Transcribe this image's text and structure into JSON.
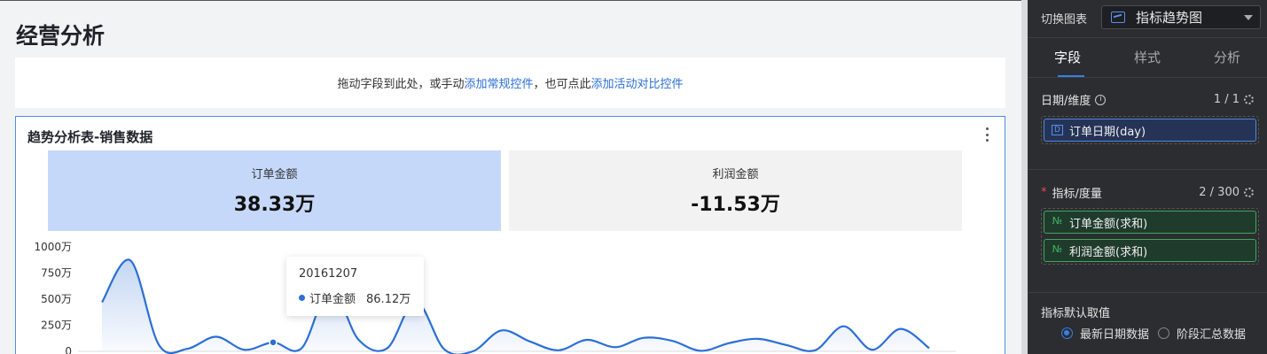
{
  "page": {
    "title": "经营分析"
  },
  "filter_bar": {
    "text_a": "拖动字段到此处，或手动",
    "link_a": "添加常规控件",
    "text_b": "，也可点此",
    "link_b": "添加活动对比控件"
  },
  "card": {
    "title": "趋势分析表-销售数据",
    "kpis": [
      {
        "label": "订单金额",
        "value": "38.33万"
      },
      {
        "label": "利润金额",
        "value": "-11.53万"
      }
    ],
    "tooltip": {
      "date": "20161207",
      "series": "订单金额",
      "value": "86.12万"
    }
  },
  "chart_data": {
    "type": "area",
    "series": [
      {
        "name": "订单金额",
        "color": "#2b6fd6",
        "values": [
          470,
          870,
          60,
          25,
          140,
          15,
          86,
          30,
          600,
          110,
          30,
          480,
          20,
          0,
          200,
          95,
          10,
          110,
          40,
          130,
          100,
          5,
          80,
          120,
          60,
          10,
          240,
          15,
          215,
          30
        ]
      }
    ],
    "y_ticks": [
      "1000万",
      "750万",
      "500万",
      "250万",
      "0"
    ],
    "ylim": [
      0,
      1000
    ],
    "highlight_index": 6,
    "grid": false
  },
  "panel": {
    "switch_label": "切换图表",
    "chart_type": "指标趋势图",
    "tabs": [
      "字段",
      "样式",
      "分析"
    ],
    "dimension": {
      "label": "日期/维度",
      "count": "1 / 1",
      "fields": [
        "订单日期(day)"
      ]
    },
    "measure": {
      "label": "指标/度量",
      "count": "2 / 300",
      "fields": [
        "订单金额(求和)",
        "利润金额(求和)"
      ]
    },
    "default": {
      "label": "指标默认取值",
      "options": [
        "最新日期数据",
        "阶段汇总数据"
      ]
    }
  }
}
